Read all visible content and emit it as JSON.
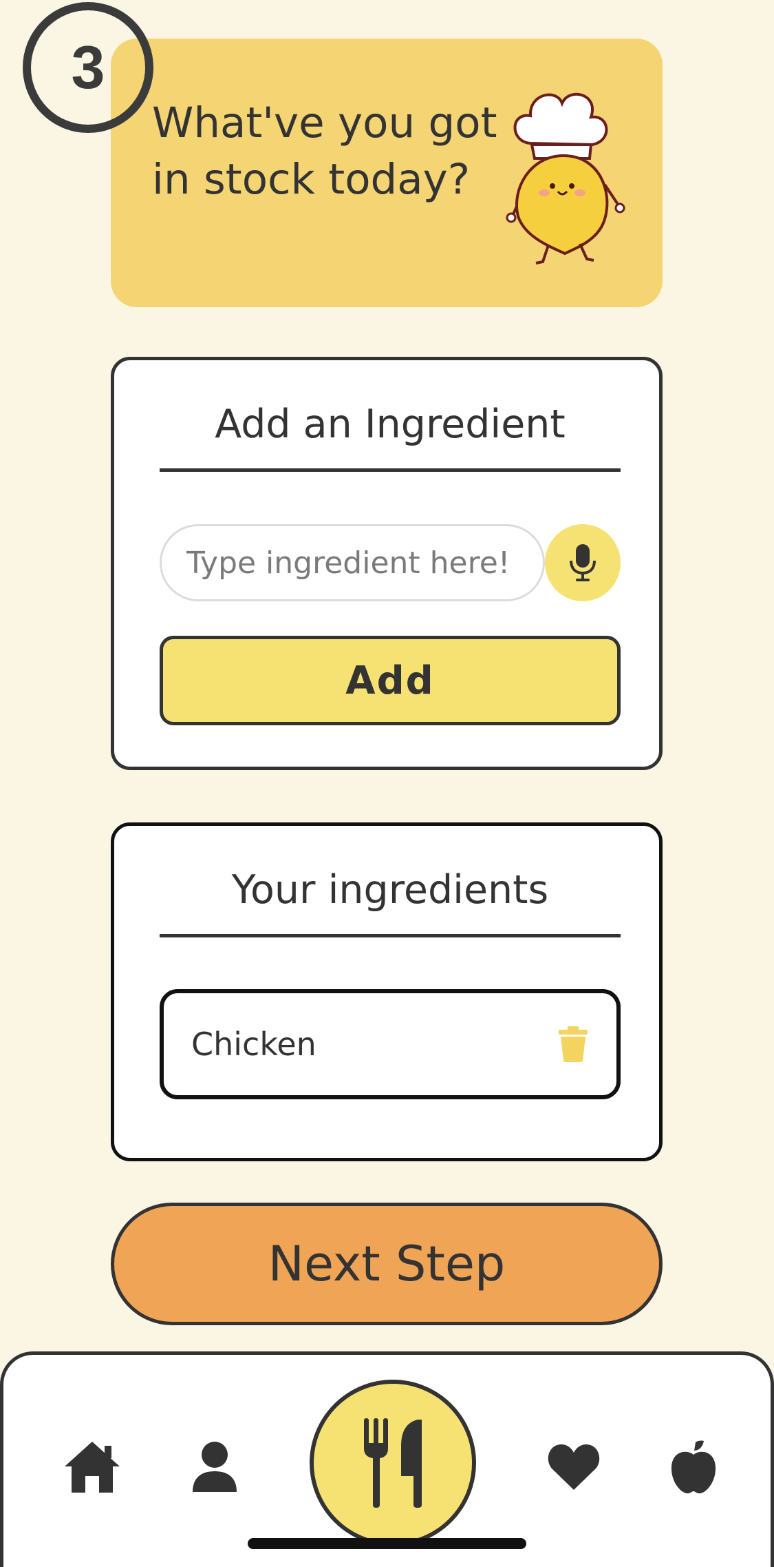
{
  "step": {
    "number": "3"
  },
  "header": {
    "title_line1": "What've you got",
    "title_line2": "in stock today?"
  },
  "add_card": {
    "title": "Add an Ingredient",
    "input_placeholder": "Type ingredient here!",
    "input_value": "",
    "mic_icon": "microphone-icon",
    "add_label": "Add"
  },
  "ingredients_card": {
    "title": "Your ingredients",
    "items": [
      {
        "name": "Chicken",
        "delete_icon": "trash-icon"
      }
    ]
  },
  "next_label": "Next Step",
  "nav": {
    "items": [
      {
        "icon": "home-icon"
      },
      {
        "icon": "user-icon"
      },
      {
        "icon": "fork-knife-icon",
        "active": true
      },
      {
        "icon": "heart-icon"
      },
      {
        "icon": "apple-icon"
      }
    ]
  },
  "colors": {
    "background": "#fbf6e4",
    "header_card": "#f4d473",
    "accent_yellow": "#f6e273",
    "next_button": "#f0a455",
    "text": "#333333"
  }
}
